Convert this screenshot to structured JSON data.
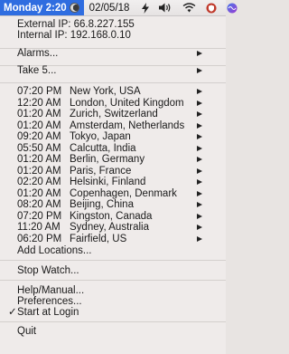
{
  "menubar": {
    "clock": "Monday 2:20",
    "date": "02/05/18",
    "icons": [
      "moon-phase-icon",
      "lightning-icon",
      "volume-icon",
      "wifi-icon",
      "shield-icon",
      "siri-icon"
    ]
  },
  "info": {
    "external_ip": "External IP: 66.8.227.155",
    "internal_ip": "Internal IP: 192.168.0.10"
  },
  "items": {
    "alarms": "Alarms...",
    "take5": "Take 5...",
    "add_locations": "Add Locations...",
    "stop_watch": "Stop Watch...",
    "help": "Help/Manual...",
    "preferences": "Preferences...",
    "start_at_login": "Start at Login",
    "start_at_login_check": "✓",
    "quit": "Quit"
  },
  "locations": [
    {
      "time": "07:20 PM",
      "city": "New York, USA"
    },
    {
      "time": "12:20 AM",
      "city": "London, United Kingdom"
    },
    {
      "time": "01:20 AM",
      "city": "Zurich, Switzerland"
    },
    {
      "time": "01:20 AM",
      "city": "Amsterdam, Netherlands"
    },
    {
      "time": "09:20 AM",
      "city": "Tokyo, Japan"
    },
    {
      "time": "05:50 AM",
      "city": "Calcutta, India"
    },
    {
      "time": "01:20 AM",
      "city": "Berlin, Germany"
    },
    {
      "time": "01:20 AM",
      "city": "Paris, France"
    },
    {
      "time": "02:20 AM",
      "city": "Helsinki, Finland"
    },
    {
      "time": "01:20 AM",
      "city": "Copenhagen, Denmark"
    },
    {
      "time": "08:20 AM",
      "city": "Beijing, China"
    },
    {
      "time": "07:20 PM",
      "city": "Kingston, Canada"
    },
    {
      "time": "11:20 AM",
      "city": "Sydney, Australia"
    },
    {
      "time": "06:20 PM",
      "city": "Fairfield, US"
    }
  ],
  "colors": {
    "accent": "#2f6de0",
    "menu_bg": "#efebea"
  }
}
